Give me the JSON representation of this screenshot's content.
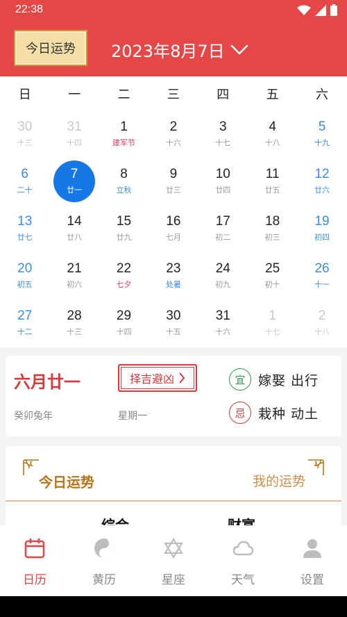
{
  "status_bar": {
    "time": "22:38"
  },
  "header": {
    "fortune_label": "今日运势",
    "date_title": "2023年8月7日"
  },
  "calendar": {
    "weekdays": [
      "日",
      "一",
      "二",
      "三",
      "四",
      "五",
      "六"
    ],
    "days": [
      {
        "day": "30",
        "lunar": "十三",
        "other": true
      },
      {
        "day": "31",
        "lunar": "十四",
        "other": true
      },
      {
        "day": "1",
        "lunar": "建军节",
        "lunar_type": "festival"
      },
      {
        "day": "2",
        "lunar": "十六"
      },
      {
        "day": "3",
        "lunar": "十七"
      },
      {
        "day": "4",
        "lunar": "十八"
      },
      {
        "day": "5",
        "lunar": "十九"
      },
      {
        "day": "6",
        "lunar": "二十"
      },
      {
        "day": "7",
        "lunar": "廿一",
        "selected": true
      },
      {
        "day": "8",
        "lunar": "立秋",
        "lunar_type": "term"
      },
      {
        "day": "9",
        "lunar": "廿三"
      },
      {
        "day": "10",
        "lunar": "廿四"
      },
      {
        "day": "11",
        "lunar": "廿五"
      },
      {
        "day": "12",
        "lunar": "廿六"
      },
      {
        "day": "13",
        "lunar": "廿七"
      },
      {
        "day": "14",
        "lunar": "廿八"
      },
      {
        "day": "15",
        "lunar": "廿九"
      },
      {
        "day": "16",
        "lunar": "七月"
      },
      {
        "day": "17",
        "lunar": "初二"
      },
      {
        "day": "18",
        "lunar": "初三"
      },
      {
        "day": "19",
        "lunar": "初四"
      },
      {
        "day": "20",
        "lunar": "初五"
      },
      {
        "day": "21",
        "lunar": "初六"
      },
      {
        "day": "22",
        "lunar": "七夕",
        "lunar_type": "festival"
      },
      {
        "day": "23",
        "lunar": "处暑",
        "lunar_type": "term"
      },
      {
        "day": "24",
        "lunar": "初九"
      },
      {
        "day": "25",
        "lunar": "初十"
      },
      {
        "day": "26",
        "lunar": "十一"
      },
      {
        "day": "27",
        "lunar": "十二"
      },
      {
        "day": "28",
        "lunar": "十三"
      },
      {
        "day": "29",
        "lunar": "十四"
      },
      {
        "day": "30",
        "lunar": "十五"
      },
      {
        "day": "31",
        "lunar": "十六"
      },
      {
        "day": "1",
        "lunar": "十七",
        "other": true
      },
      {
        "day": "2",
        "lunar": "十八",
        "other": true
      }
    ]
  },
  "info": {
    "lunar_date": "六月廿一",
    "ganzhi_year": "癸卯兔年",
    "weekday": "星期一",
    "auspicious_button": "择吉避凶",
    "yi_label": "宜",
    "yi_items": "嫁娶 出行",
    "ji_label": "忌",
    "ji_items": "栽种 动土"
  },
  "fortune": {
    "left_title": "今日运势",
    "right_title": "我的运势",
    "sub_left": "综合",
    "sub_right": "财富"
  },
  "bottom_nav": [
    {
      "label": "日历",
      "icon": "calendar-icon",
      "active": true
    },
    {
      "label": "黄历",
      "icon": "yin-yang-icon"
    },
    {
      "label": "星座",
      "icon": "star-of-david-icon"
    },
    {
      "label": "天气",
      "icon": "cloud-icon"
    },
    {
      "label": "设置",
      "icon": "person-icon"
    }
  ],
  "colors": {
    "brand_red": "#e54646",
    "selected_blue": "#1677e6",
    "weekend_blue": "#3a8de0",
    "festival_pink": "#e53c6a",
    "yi_green": "#2f9a4c",
    "fortune_gold": "#b8741a"
  }
}
